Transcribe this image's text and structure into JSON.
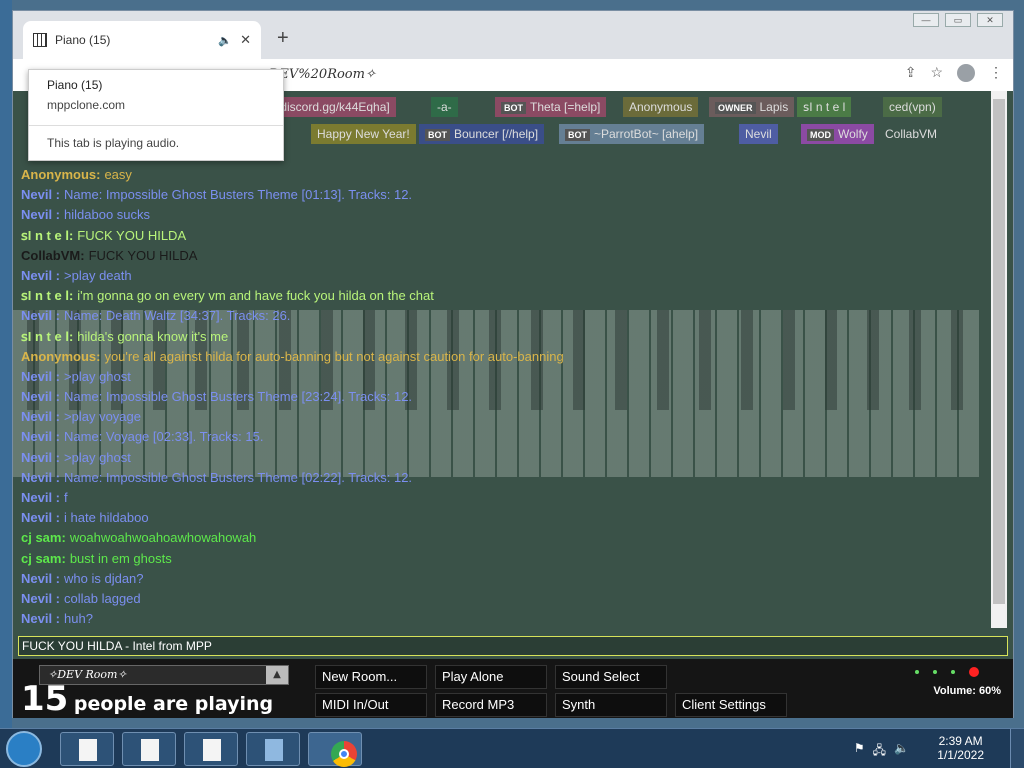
{
  "browser": {
    "tab_title": "Piano (15)",
    "new_tab": "+",
    "address": "DEV%20Room✧",
    "window_buttons": [
      "—",
      "▭",
      "✕"
    ]
  },
  "popup": {
    "title": "Piano (15)",
    "domain": "mppclone.com",
    "status": "This tab is playing audio."
  },
  "names": [
    {
      "tag": "",
      "label": "[discord.gg/k44Eqha]",
      "color": "#8b4a63"
    },
    {
      "tag": "",
      "label": "-a-",
      "color": "#2f6b48"
    },
    {
      "tag": "BOT",
      "label": "Theta [=help]",
      "color": "#8b4a63"
    },
    {
      "tag": "",
      "label": "Anonymous",
      "color": "#6b6b3a"
    },
    {
      "tag": "OWNER",
      "label": "Lapis",
      "color": "#6b5c5c"
    },
    {
      "tag": "",
      "label": "ꜱI n t e l",
      "color": "#4b7b46"
    },
    {
      "tag": "",
      "label": "ced(vpn)",
      "color": "#4b6b46"
    },
    {
      "tag": "",
      "label": "Happy New Year!",
      "color": "#7b7b30"
    },
    {
      "tag": "BOT",
      "label": "Bouncer [//help]",
      "color": "#3a4e88"
    },
    {
      "tag": "BOT",
      "label": "~ParrotBot~ [ahelp]",
      "color": "#657f94"
    },
    {
      "tag": "",
      "label": "Nevil",
      "color": "#4e5da3"
    },
    {
      "tag": "MOD",
      "label": "Wolfy",
      "color": "#8b4aa3"
    },
    {
      "tag": "",
      "label": "CollabVM",
      "color": "transparent"
    }
  ],
  "chat": [
    {
      "user": "Anonymous:",
      "msg": "easy",
      "cls": "c-anon"
    },
    {
      "user": "Nevil :",
      "msg": "Name: Impossible Ghost Busters Theme [01:13]. Tracks: 12.",
      "cls": "c-nevil"
    },
    {
      "user": "Nevil :",
      "msg": "hildaboo sucks",
      "cls": "c-nevil"
    },
    {
      "user": "ꜱI n t e l:",
      "msg": "FUCK YOU HILDA",
      "cls": "c-intel"
    },
    {
      "user": "CollabVM:",
      "msg": "FUCK YOU HILDA",
      "cls": "c-collab"
    },
    {
      "user": "Nevil :",
      "msg": ">play death",
      "cls": "c-nevil"
    },
    {
      "user": "ꜱI n t e l:",
      "msg": "i'm gonna go on every vm and have fuck you hilda on the chat",
      "cls": "c-intel"
    },
    {
      "user": "Nevil :",
      "msg": "Name: Death Waltz [34:37]. Tracks: 26.",
      "cls": "c-nevil"
    },
    {
      "user": "ꜱI n t e l:",
      "msg": "hilda's gonna know it's me",
      "cls": "c-intel"
    },
    {
      "user": "Anonymous:",
      "msg": "you're all against hilda for auto-banning but not against caution for auto-banning",
      "cls": "c-anon"
    },
    {
      "user": "Nevil :",
      "msg": ">play ghost",
      "cls": "c-nevil"
    },
    {
      "user": "Nevil :",
      "msg": "Name: Impossible Ghost Busters Theme [23:24]. Tracks: 12.",
      "cls": "c-nevil"
    },
    {
      "user": "Nevil :",
      "msg": ">play voyage",
      "cls": "c-nevil"
    },
    {
      "user": "Nevil :",
      "msg": "Name: Voyage [02:33]. Tracks: 15.",
      "cls": "c-nevil"
    },
    {
      "user": "Nevil :",
      "msg": ">play ghost",
      "cls": "c-nevil"
    },
    {
      "user": "Nevil :",
      "msg": "Name: Impossible Ghost Busters Theme [02:22]. Tracks: 12.",
      "cls": "c-nevil"
    },
    {
      "user": "Nevil :",
      "msg": "f",
      "cls": "c-nevil"
    },
    {
      "user": "Nevil :",
      "msg": "i hate hildaboo",
      "cls": "c-nevil"
    },
    {
      "user": "cj sam:",
      "msg": "woahwoahwoahoawhowahowah",
      "cls": "c-cj"
    },
    {
      "user": "cj sam:",
      "msg": "bust in em ghosts",
      "cls": "c-cj"
    },
    {
      "user": "Nevil :",
      "msg": "who is djdan?",
      "cls": "c-nevil"
    },
    {
      "user": "Nevil :",
      "msg": "collab lagged",
      "cls": "c-nevil"
    },
    {
      "user": "Nevil :",
      "msg": "huh?",
      "cls": "c-nevil"
    }
  ],
  "chat_input": "FUCK YOU HILDA - Intel from MPP",
  "bottom": {
    "room": "✧DEV Room✧",
    "player_count": "15",
    "players_text": "people are playing",
    "buttons": {
      "new_room": "New Room...",
      "play_alone": "Play Alone",
      "sound_select": "Sound Select",
      "midi": "MIDI In/Out",
      "record": "Record MP3",
      "synth": "Synth",
      "client_settings": "Client Settings"
    },
    "volume": "Volume: 60%"
  },
  "taskbar": {
    "time": "2:39 AM",
    "date": "1/1/2022"
  }
}
